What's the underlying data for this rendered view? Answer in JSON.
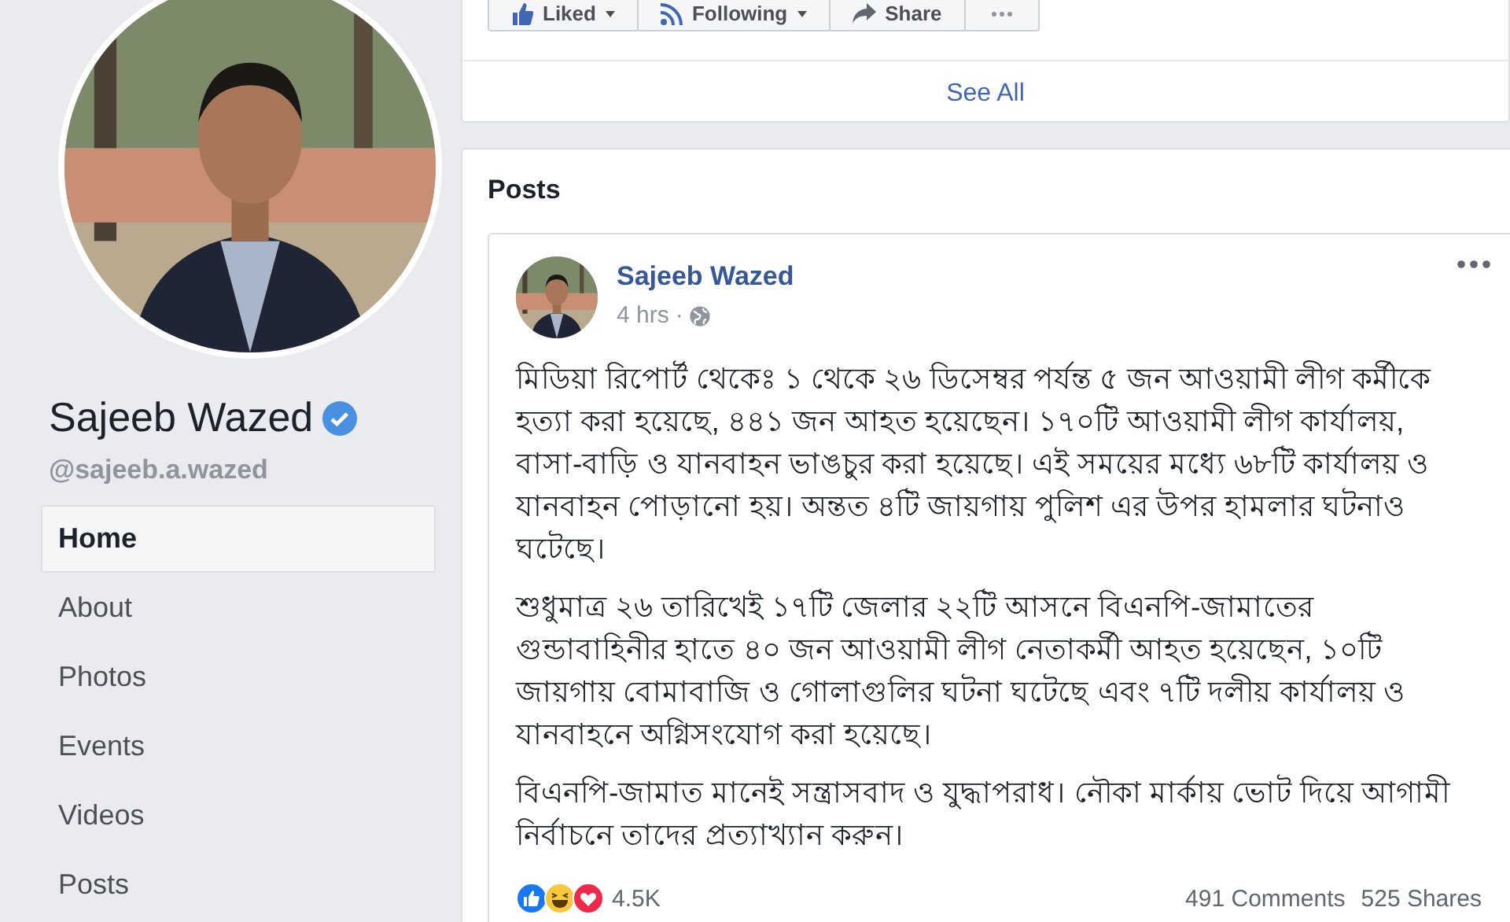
{
  "page": {
    "name": "Sajeeb Wazed",
    "verified": true,
    "handle": "@sajeeb.a.wazed"
  },
  "nav": [
    {
      "label": "Home",
      "selected": true
    },
    {
      "label": "About",
      "selected": false
    },
    {
      "label": "Photos",
      "selected": false
    },
    {
      "label": "Events",
      "selected": false
    },
    {
      "label": "Videos",
      "selected": false
    },
    {
      "label": "Posts",
      "selected": false
    }
  ],
  "actions": [
    {
      "kind": "liked",
      "label": "Liked",
      "dropdown": true
    },
    {
      "kind": "following",
      "label": "Following",
      "dropdown": true
    },
    {
      "kind": "share",
      "label": "Share",
      "dropdown": false
    },
    {
      "kind": "more"
    }
  ],
  "see_all": "See All",
  "posts_heading": "Posts",
  "post": {
    "author": "Sajeeb Wazed",
    "time": "4 hrs",
    "separator": "·",
    "paragraphs": [
      "মিডিয়া রিপোর্ট থেকেঃ ১ থেকে ২৬ ডিসেম্বর পর্যন্ত ৫ জন আওয়ামী লীগ কর্মীকে হত্যা করা হয়েছে, ৪৪১ জন আহত হয়েছেন। ১৭০টি আওয়ামী লীগ কার্যালয়, বাসা-বাড়ি ও যানবাহন ভাঙচুর করা হয়েছে। এই সময়ের মধ্যে ৬৮টি কার্যালয় ও যানবাহন পোড়ানো হয়। অন্তত ৪টি জায়গায় পুলিশ এর উপর হামলার ঘটনাও ঘটেছে।",
      "শুধুমাত্র ২৬ তারিখেই ১৭টি জেলার ২২টি আসনে বিএনপি-জামাতের গুন্ডাবাহিনীর হাতে ৪০ জন আওয়ামী লীগ নেতাকর্মী আহত হয়েছেন, ১০টি জায়গায় বোমাবাজি ও গোলাগুলির ঘটনা ঘটেছে এবং ৭টি দলীয় কার্যালয় ও যানবাহনে অগ্নিসংযোগ করা হয়েছে।",
      "বিএনপি-জামাত মানেই সন্ত্রাসবাদ ও যুদ্ধাপরাধ। নৌকা মার্কায় ভোট দিয়ে আগামী নির্বাচনে তাদের প্রত্যাখ্যান করুন।"
    ],
    "reactions": [
      {
        "kind": "like"
      },
      {
        "kind": "haha"
      },
      {
        "kind": "love"
      }
    ],
    "reaction_count": "4.5K",
    "comments": "491 Comments",
    "shares": "525 Shares"
  }
}
